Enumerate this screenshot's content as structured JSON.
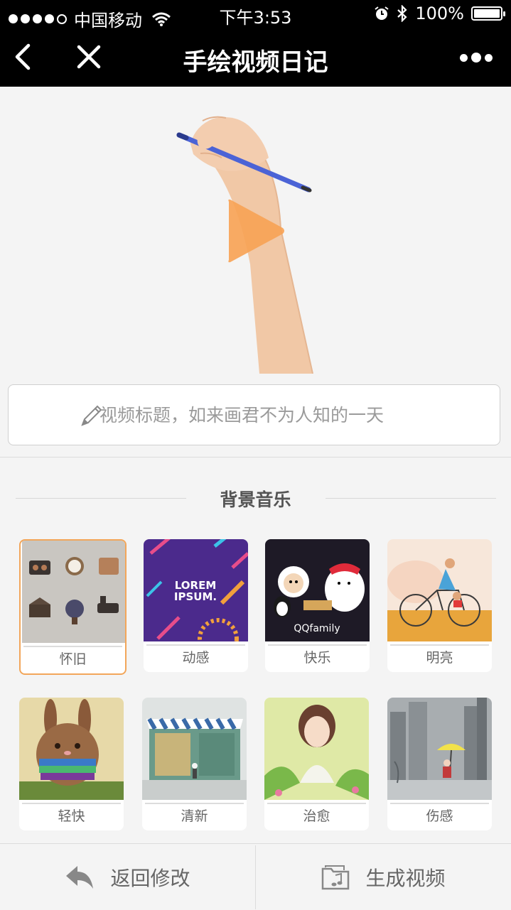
{
  "status_bar": {
    "carrier": "中国移动",
    "time": "下午3:53",
    "battery": "100%"
  },
  "nav": {
    "title": "手绘视频日记"
  },
  "title_input": {
    "placeholder": "视频标题，如来画君不为人知的一天",
    "value": ""
  },
  "music": {
    "heading": "背景音乐",
    "selected": "怀旧",
    "items": [
      {
        "label": "怀旧",
        "icon": "vintage-thumbnail"
      },
      {
        "label": "动感",
        "icon": "dynamic-thumbnail",
        "thumb_text_1": "LOREM",
        "thumb_text_2": "IPSUM."
      },
      {
        "label": "快乐",
        "icon": "happy-thumbnail",
        "thumb_text": "QQfamily"
      },
      {
        "label": "明亮",
        "icon": "bright-thumbnail"
      },
      {
        "label": "轻快",
        "icon": "light-thumbnail"
      },
      {
        "label": "清新",
        "icon": "fresh-thumbnail"
      },
      {
        "label": "治愈",
        "icon": "healing-thumbnail"
      },
      {
        "label": "伤感",
        "icon": "sad-thumbnail"
      }
    ]
  },
  "bottom": {
    "back_label": "返回修改",
    "generate_label": "生成视频"
  },
  "colors": {
    "accent": "#f2a65a",
    "play": "#f7a356",
    "pen": "#4b63d6"
  }
}
